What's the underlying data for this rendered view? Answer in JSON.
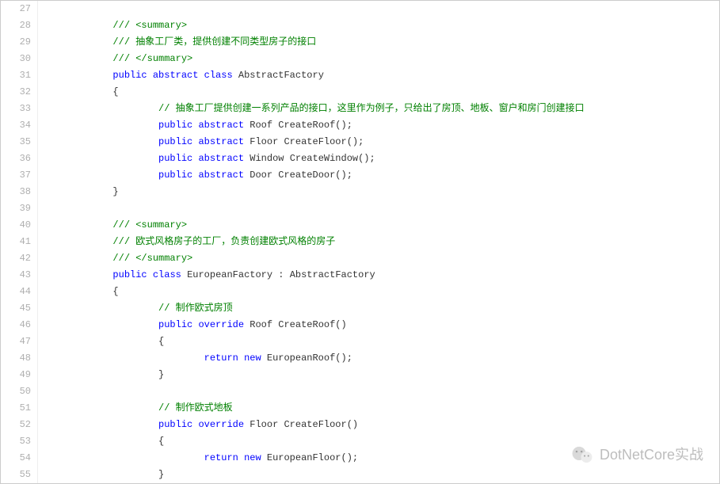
{
  "watermark_text": "DotNetCore实战",
  "lines": [
    {
      "n": 27,
      "indent": 0,
      "tokens": []
    },
    {
      "n": 28,
      "indent": 2,
      "tokens": [
        {
          "t": "cm",
          "v": "/// <summary>"
        }
      ]
    },
    {
      "n": 29,
      "indent": 2,
      "tokens": [
        {
          "t": "cm",
          "v": "/// 抽象工厂类，提供创建不同类型房子的接口"
        }
      ]
    },
    {
      "n": 30,
      "indent": 2,
      "tokens": [
        {
          "t": "cm",
          "v": "/// </summary>"
        }
      ]
    },
    {
      "n": 31,
      "indent": 2,
      "tokens": [
        {
          "t": "kw",
          "v": "public"
        },
        {
          "t": "sp"
        },
        {
          "t": "kw",
          "v": "abstract"
        },
        {
          "t": "sp"
        },
        {
          "t": "kw",
          "v": "class"
        },
        {
          "t": "sp"
        },
        {
          "t": "ty",
          "v": "AbstractFactory"
        }
      ]
    },
    {
      "n": 32,
      "indent": 2,
      "tokens": [
        {
          "t": "pn",
          "v": "{"
        }
      ]
    },
    {
      "n": 33,
      "indent": 4,
      "tokens": [
        {
          "t": "cm",
          "v": "// 抽象工厂提供创建一系列产品的接口，这里作为例子，只给出了房顶、地板、窗户和房门创建接口"
        }
      ]
    },
    {
      "n": 34,
      "indent": 4,
      "tokens": [
        {
          "t": "kw",
          "v": "public"
        },
        {
          "t": "sp"
        },
        {
          "t": "kw",
          "v": "abstract"
        },
        {
          "t": "sp"
        },
        {
          "t": "ty",
          "v": "Roof"
        },
        {
          "t": "sp"
        },
        {
          "t": "id",
          "v": "CreateRoof"
        },
        {
          "t": "pn",
          "v": "();"
        }
      ]
    },
    {
      "n": 35,
      "indent": 4,
      "tokens": [
        {
          "t": "kw",
          "v": "public"
        },
        {
          "t": "sp"
        },
        {
          "t": "kw",
          "v": "abstract"
        },
        {
          "t": "sp"
        },
        {
          "t": "ty",
          "v": "Floor"
        },
        {
          "t": "sp"
        },
        {
          "t": "id",
          "v": "CreateFloor"
        },
        {
          "t": "pn",
          "v": "();"
        }
      ]
    },
    {
      "n": 36,
      "indent": 4,
      "tokens": [
        {
          "t": "kw",
          "v": "public"
        },
        {
          "t": "sp"
        },
        {
          "t": "kw",
          "v": "abstract"
        },
        {
          "t": "sp"
        },
        {
          "t": "ty",
          "v": "Window"
        },
        {
          "t": "sp"
        },
        {
          "t": "id",
          "v": "CreateWindow"
        },
        {
          "t": "pn",
          "v": "();"
        }
      ]
    },
    {
      "n": 37,
      "indent": 4,
      "tokens": [
        {
          "t": "kw",
          "v": "public"
        },
        {
          "t": "sp"
        },
        {
          "t": "kw",
          "v": "abstract"
        },
        {
          "t": "sp"
        },
        {
          "t": "ty",
          "v": "Door"
        },
        {
          "t": "sp"
        },
        {
          "t": "id",
          "v": "CreateDoor"
        },
        {
          "t": "pn",
          "v": "();"
        }
      ]
    },
    {
      "n": 38,
      "indent": 2,
      "tokens": [
        {
          "t": "pn",
          "v": "}"
        }
      ]
    },
    {
      "n": 39,
      "indent": 0,
      "tokens": []
    },
    {
      "n": 40,
      "indent": 2,
      "tokens": [
        {
          "t": "cm",
          "v": "/// <summary>"
        }
      ]
    },
    {
      "n": 41,
      "indent": 2,
      "tokens": [
        {
          "t": "cm",
          "v": "/// 欧式风格房子的工厂，负责创建欧式风格的房子"
        }
      ]
    },
    {
      "n": 42,
      "indent": 2,
      "tokens": [
        {
          "t": "cm",
          "v": "/// </summary>"
        }
      ]
    },
    {
      "n": 43,
      "indent": 2,
      "tokens": [
        {
          "t": "kw",
          "v": "public"
        },
        {
          "t": "sp"
        },
        {
          "t": "kw",
          "v": "class"
        },
        {
          "t": "sp"
        },
        {
          "t": "ty",
          "v": "EuropeanFactory"
        },
        {
          "t": "sp"
        },
        {
          "t": "pn",
          "v": ":"
        },
        {
          "t": "sp"
        },
        {
          "t": "ty",
          "v": "AbstractFactory"
        }
      ]
    },
    {
      "n": 44,
      "indent": 2,
      "tokens": [
        {
          "t": "pn",
          "v": "{"
        }
      ]
    },
    {
      "n": 45,
      "indent": 4,
      "tokens": [
        {
          "t": "cm",
          "v": "// 制作欧式房顶"
        }
      ]
    },
    {
      "n": 46,
      "indent": 4,
      "tokens": [
        {
          "t": "kw",
          "v": "public"
        },
        {
          "t": "sp"
        },
        {
          "t": "kw",
          "v": "override"
        },
        {
          "t": "sp"
        },
        {
          "t": "ty",
          "v": "Roof"
        },
        {
          "t": "sp"
        },
        {
          "t": "id",
          "v": "CreateRoof"
        },
        {
          "t": "pn",
          "v": "()"
        }
      ]
    },
    {
      "n": 47,
      "indent": 4,
      "tokens": [
        {
          "t": "pn",
          "v": "{"
        }
      ]
    },
    {
      "n": 48,
      "indent": 6,
      "tokens": [
        {
          "t": "kw",
          "v": "return"
        },
        {
          "t": "sp"
        },
        {
          "t": "kw",
          "v": "new"
        },
        {
          "t": "sp"
        },
        {
          "t": "ty",
          "v": "EuropeanRoof"
        },
        {
          "t": "pn",
          "v": "();"
        }
      ]
    },
    {
      "n": 49,
      "indent": 4,
      "tokens": [
        {
          "t": "pn",
          "v": "}"
        }
      ]
    },
    {
      "n": 50,
      "indent": 0,
      "tokens": []
    },
    {
      "n": 51,
      "indent": 4,
      "tokens": [
        {
          "t": "cm",
          "v": "// 制作欧式地板"
        }
      ]
    },
    {
      "n": 52,
      "indent": 4,
      "tokens": [
        {
          "t": "kw",
          "v": "public"
        },
        {
          "t": "sp"
        },
        {
          "t": "kw",
          "v": "override"
        },
        {
          "t": "sp"
        },
        {
          "t": "ty",
          "v": "Floor"
        },
        {
          "t": "sp"
        },
        {
          "t": "id",
          "v": "CreateFloor"
        },
        {
          "t": "pn",
          "v": "()"
        }
      ]
    },
    {
      "n": 53,
      "indent": 4,
      "tokens": [
        {
          "t": "pn",
          "v": "{"
        }
      ]
    },
    {
      "n": 54,
      "indent": 6,
      "tokens": [
        {
          "t": "kw",
          "v": "return"
        },
        {
          "t": "sp"
        },
        {
          "t": "kw",
          "v": "new"
        },
        {
          "t": "sp"
        },
        {
          "t": "ty",
          "v": "EuropeanFloor"
        },
        {
          "t": "pn",
          "v": "();"
        }
      ]
    },
    {
      "n": 55,
      "indent": 4,
      "tokens": [
        {
          "t": "pn",
          "v": "}"
        }
      ]
    }
  ]
}
